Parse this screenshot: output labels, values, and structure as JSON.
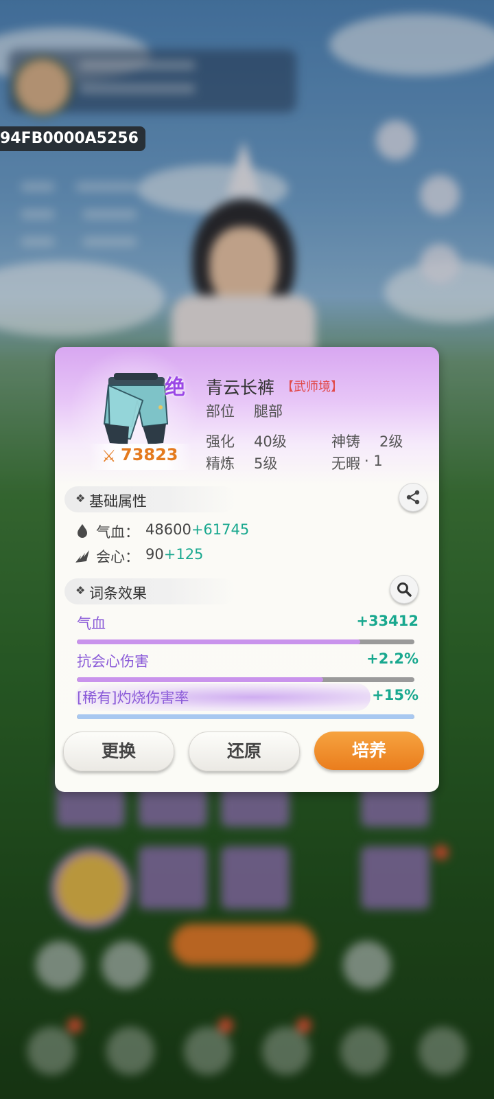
{
  "device_id": "94FB0000A5256",
  "item": {
    "grade_badge": "绝",
    "power_value": "73823",
    "name": "青云长裤",
    "realm": "【武师境】",
    "slot_label": "部位",
    "slot_value": "腿部",
    "enhance_label": "强化",
    "enhance_value": "40级",
    "divine_cast_label": "神铸",
    "divine_cast_value": "2级",
    "refine_label": "精炼",
    "refine_value": "5级",
    "flawless_label": "无暇",
    "flawless_value": "· 1"
  },
  "base_attributes": {
    "title": "基础属性",
    "rows": [
      {
        "icon": "blood-drop-icon",
        "name": "气血：",
        "base": "48600",
        "bonus": "+61745"
      },
      {
        "icon": "crit-icon",
        "name": "会心：",
        "base": "90",
        "bonus": "+125"
      }
    ]
  },
  "affixes": {
    "title": "词条效果",
    "rows": [
      {
        "name": "气血",
        "value": "+33412",
        "fill": 0.84,
        "color": "#c993ec"
      },
      {
        "name": "抗会心伤害",
        "value": "+2.2%",
        "fill": 0.73,
        "color": "#c993ec"
      },
      {
        "name": "[稀有]灼烧伤害率",
        "value": "+15%",
        "fill": 1.0,
        "color": "#a8c8f0"
      }
    ]
  },
  "buttons": {
    "replace": "更换",
    "restore": "还原",
    "cultivate": "培养"
  },
  "colors": {
    "power": "#e47a1e",
    "realm": "#e14a4a",
    "bonus": "#19a88f",
    "affix_name": "#8a5ad8",
    "cultivate_button": "#ea7d1d"
  }
}
